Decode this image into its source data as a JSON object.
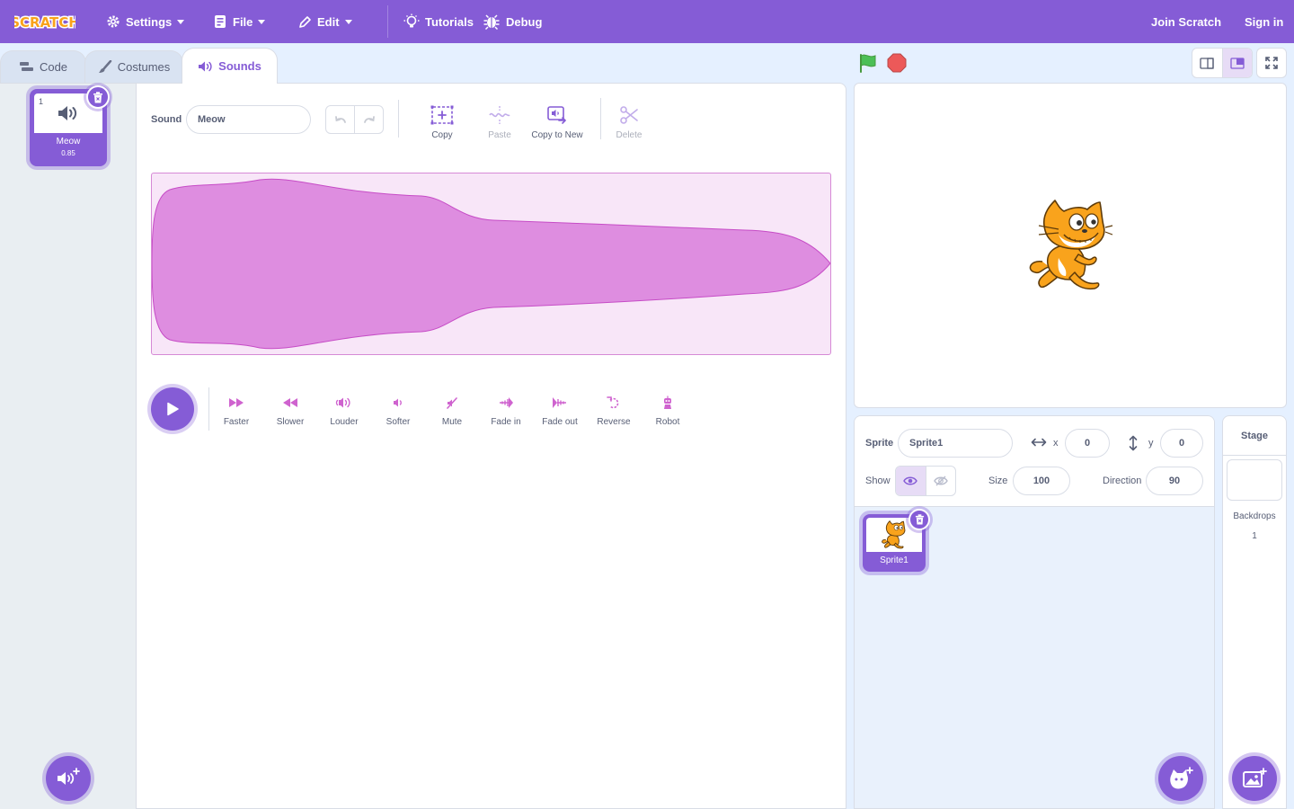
{
  "menu": {
    "logo_text": "SCRATCH",
    "settings": "Settings",
    "file": "File",
    "edit": "Edit",
    "tutorials": "Tutorials",
    "debug": "Debug",
    "join": "Join Scratch",
    "signin": "Sign in"
  },
  "tabs": {
    "code": "Code",
    "costumes": "Costumes",
    "sounds": "Sounds"
  },
  "sound_list": {
    "items": [
      {
        "index": "1",
        "name": "Meow",
        "duration": "0.85"
      }
    ]
  },
  "editor": {
    "sound_label": "Sound",
    "sound_name": "Meow",
    "tools": {
      "copy": "Copy",
      "paste": "Paste",
      "copy_to_new": "Copy to New",
      "delete": "Delete"
    },
    "effects": {
      "faster": "Faster",
      "slower": "Slower",
      "louder": "Louder",
      "softer": "Softer",
      "mute": "Mute",
      "fade_in": "Fade in",
      "fade_out": "Fade out",
      "reverse": "Reverse",
      "robot": "Robot"
    }
  },
  "sprite_info": {
    "sprite_label": "Sprite",
    "sprite_name": "Sprite1",
    "x_label": "x",
    "x_value": "0",
    "y_label": "y",
    "y_value": "0",
    "show_label": "Show",
    "size_label": "Size",
    "size_value": "100",
    "direction_label": "Direction",
    "direction_value": "90"
  },
  "sprites": [
    {
      "name": "Sprite1"
    }
  ],
  "stage_pane": {
    "title": "Stage",
    "backdrops_label": "Backdrops",
    "backdrops_count": "1"
  },
  "colors": {
    "primary": "#855cd6",
    "background": "#e5f0ff",
    "text": "#575e75",
    "wave_fill": "#de8de0",
    "wave_bg": "#f8e6f8",
    "green_flag": "#4cbf56",
    "stop": "#ec5959",
    "cat_orange": "#f9a31c"
  }
}
